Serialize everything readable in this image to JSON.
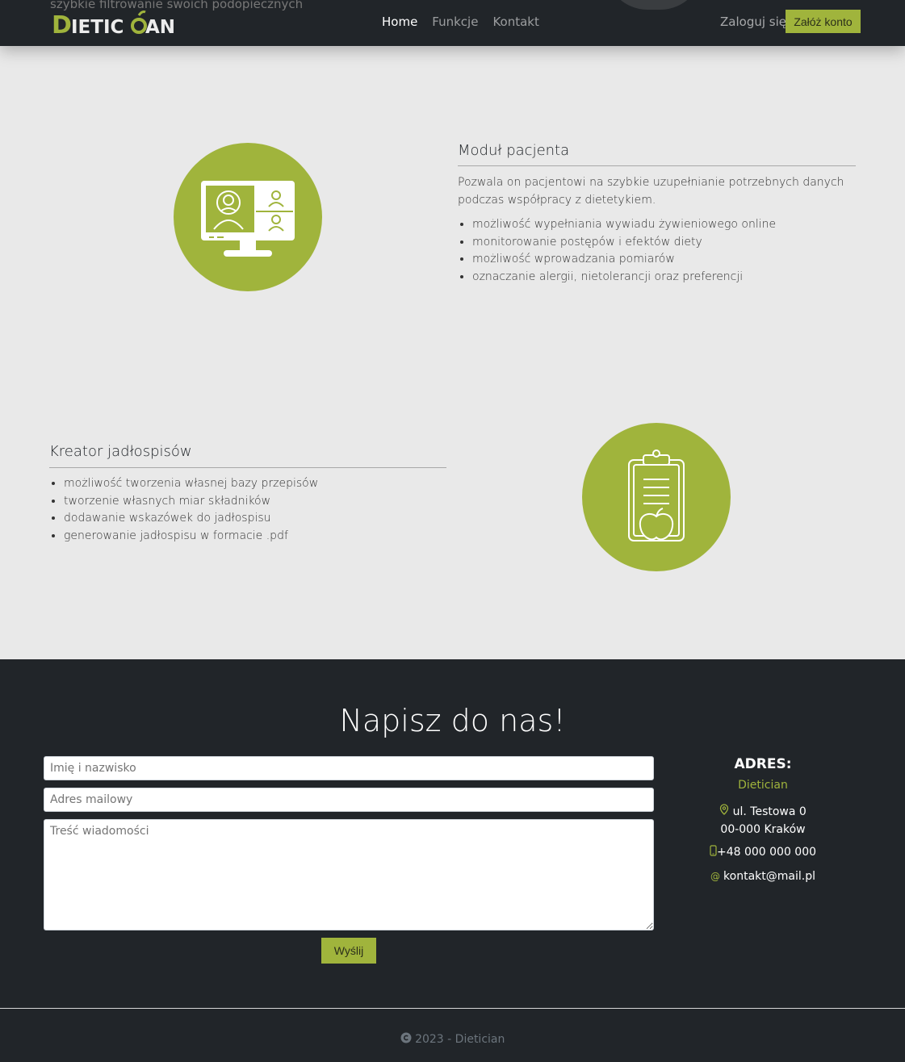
{
  "navbar": {
    "logo_text": "DIETICIAN",
    "links": [
      "Home",
      "Funkcje",
      "Kontakt"
    ],
    "login": "Zaloguj się",
    "register": "Załóż konto"
  },
  "peek_text": "szybkie filtrowanie swoich podopiecznych",
  "features": {
    "patient": {
      "title": "Moduł pacjenta",
      "description": "Pozwala on pacjentowi na szybkie uzupełnianie potrzebnych danych podczas współpracy z dietetykiem.",
      "items": [
        "możliwość wypełniania wywiadu żywieniowego online",
        "monitorowanie postępów i efektów diety",
        "możliwość wprowadzania pomiarów",
        "oznaczanie alergii, nietolerancji oraz preferencji"
      ]
    },
    "menu": {
      "title": "Kreator jadłospisów",
      "items": [
        "możliwość tworzenia własnej bazy przepisów",
        "tworzenie własnych miar składników",
        "dodawanie wskazówek do jadłospisu",
        "generowanie jadłospisu w formacie .pdf"
      ]
    }
  },
  "contact": {
    "title": "Napisz do nas!",
    "name_placeholder": "Imię i nazwisko",
    "email_placeholder": "Adres mailowy",
    "message_placeholder": "Treść wiadomości",
    "send": "Wyślij",
    "address_title": "ADRES:",
    "company": "Dietician",
    "street": "ul. Testowa 0",
    "city": "00-000 Kraków",
    "phone": "+48 000 000 000",
    "email": "kontakt@mail.pl"
  },
  "footer": {
    "text": "2023 - Dietician"
  },
  "colors": {
    "accent": "#a0b43c",
    "dark": "#212529",
    "light_bg": "#e9e9e9"
  }
}
